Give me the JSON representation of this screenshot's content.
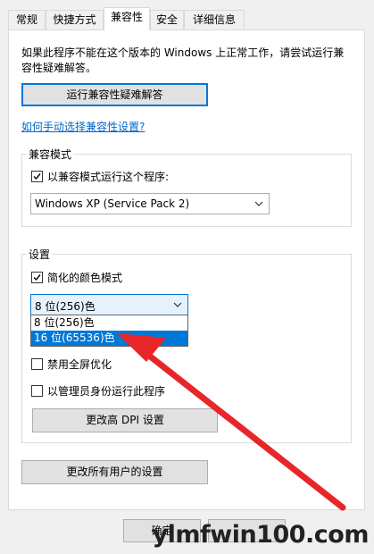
{
  "tabs": [
    {
      "label": "常规",
      "active": false
    },
    {
      "label": "快捷方式",
      "active": false
    },
    {
      "label": "兼容性",
      "active": true
    },
    {
      "label": "安全",
      "active": false
    },
    {
      "label": "详细信息",
      "active": false
    }
  ],
  "intro": {
    "line1": "如果此程序不能在这个版本的 Windows 上正常工作，请尝试运行兼",
    "line2": "容性疑难解答。"
  },
  "troubleshoot_button": "运行兼容性疑难解答",
  "manual_link": "如何手动选择兼容性设置?",
  "compat_mode": {
    "title": "兼容模式",
    "checkbox_label": "以兼容模式运行这个程序:",
    "checked": true,
    "selected_os": "Windows XP (Service Pack 2)"
  },
  "settings": {
    "title": "设置",
    "reduced_color": {
      "label": "简化的颜色模式",
      "checked": true
    },
    "color_combo": {
      "selected": "8 位(256)色",
      "options": [
        "8 位(256)色",
        "16 位(65536)色"
      ],
      "highlighted_index": 1
    },
    "disable_fullscreen": {
      "label": "禁用全屏优化",
      "checked": false
    },
    "run_as_admin": {
      "label": "以管理员身份运行此程序",
      "checked": false
    },
    "dpi_button": "更改高 DPI 设置"
  },
  "all_users_button": "更改所有用户的设置",
  "ok_button": "确定",
  "watermark": "ylmfwin100.com",
  "colors": {
    "accent": "#0078d7",
    "arrow": "#e8262a",
    "link": "#0066cc"
  }
}
